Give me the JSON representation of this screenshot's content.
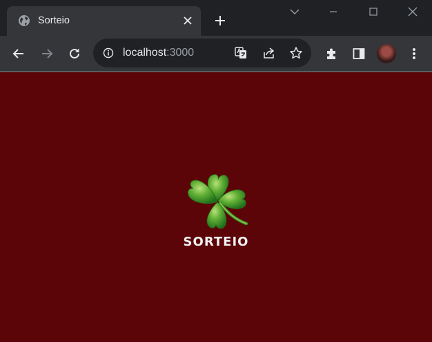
{
  "tab": {
    "title": "Sorteio",
    "favicon": "globe-icon"
  },
  "window_controls": [
    "chevron-down-icon",
    "minimize-icon",
    "maximize-icon",
    "close-icon"
  ],
  "address_bar": {
    "host": "localhost",
    "port": ":3000",
    "leading_icon": "info-icon",
    "actions": [
      "translate-icon",
      "share-icon",
      "bookmark-star-icon"
    ]
  },
  "toolbar": {
    "nav": [
      "back-arrow-icon",
      "forward-arrow-icon",
      "reload-icon"
    ],
    "right": [
      "extensions-puzzle-icon",
      "side-panel-icon",
      "profile-avatar",
      "menu-kebab-icon"
    ]
  },
  "page": {
    "background": "#5c0508",
    "brand_text": "SORTEIO",
    "logo": "four-leaf-clover-icon"
  }
}
